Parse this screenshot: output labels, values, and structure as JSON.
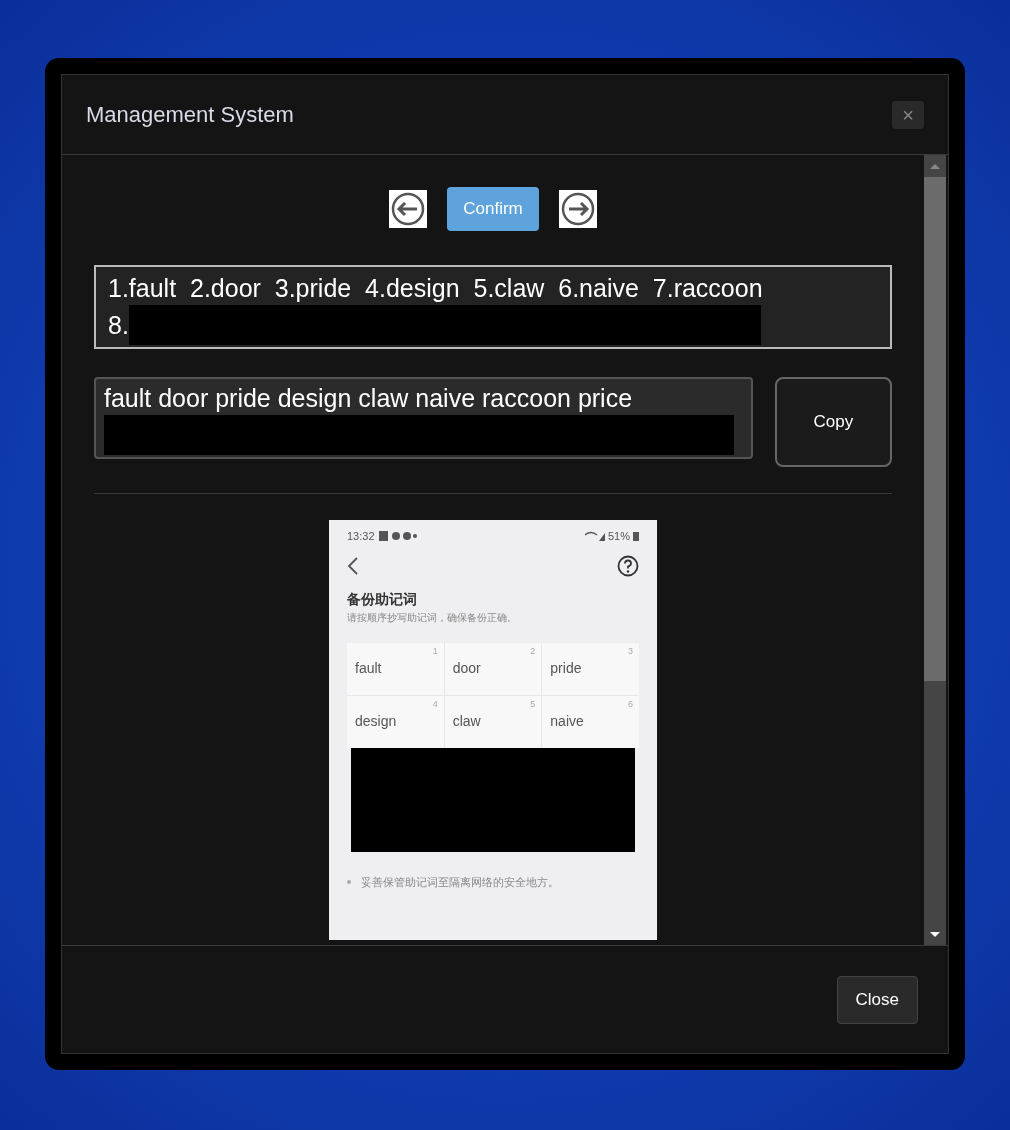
{
  "dialog": {
    "title": "Management System",
    "close_glyph": "×"
  },
  "nav": {
    "confirm": "Confirm"
  },
  "numbered_field": {
    "lines": [
      "1.fault  2.door  3.pride  4.design  5.claw  6.naive  7.raccoon",
      "8."
    ]
  },
  "plain_field": {
    "text": "fault door pride design claw naive raccoon price"
  },
  "copy_button": "Copy",
  "phone": {
    "time": "13:32",
    "battery": "51%",
    "title": "备份助记词",
    "subtitle": "请按顺序抄写助记词，确保备份正确。",
    "words": [
      {
        "index": "1",
        "word": "fault"
      },
      {
        "index": "2",
        "word": "door"
      },
      {
        "index": "3",
        "word": "pride"
      },
      {
        "index": "4",
        "word": "design"
      },
      {
        "index": "5",
        "word": "claw"
      },
      {
        "index": "6",
        "word": "naive"
      }
    ],
    "tips": [
      "妥善保管助记词至隔离网络的安全地方。"
    ]
  },
  "footer": {
    "close": "Close"
  }
}
